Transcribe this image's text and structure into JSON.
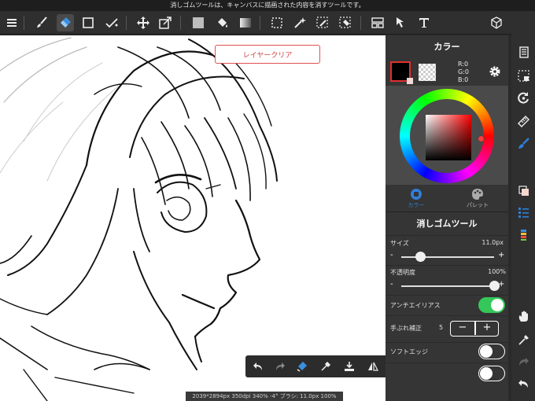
{
  "hint_text": "消しゴムツールは、キャンバスに描画された内容を消すツールです。",
  "canvas": {
    "clear_layer_label": "レイヤークリア"
  },
  "status_bar": "2039*2894px 350dpi 340% -4° ブラシ: 11.0px 100%",
  "color_panel": {
    "title": "カラー",
    "rgb": {
      "r": "R:0",
      "g": "G:0",
      "b": "B:0"
    },
    "tabs": [
      {
        "label": "カラー"
      },
      {
        "label": "パレット"
      }
    ],
    "foreground_color": "#000000",
    "accent": "#2f7fd8"
  },
  "eraser_panel": {
    "title": "消しゴムツール",
    "size_label": "サイズ",
    "size_value": "11.0px",
    "size_fraction": 0.2,
    "opacity_label": "不透明度",
    "opacity_value": "100%",
    "opacity_fraction": 1.0,
    "antialias_label": "アンチエイリアス",
    "antialias_on": true,
    "stabilizer_label": "手ぶれ補正",
    "stabilizer_value": "5",
    "soft_edge_label": "ソフトエッジ",
    "soft_edge_on": false,
    "minus": "-",
    "plus": "+",
    "step_minus": "−",
    "step_plus": "+"
  }
}
